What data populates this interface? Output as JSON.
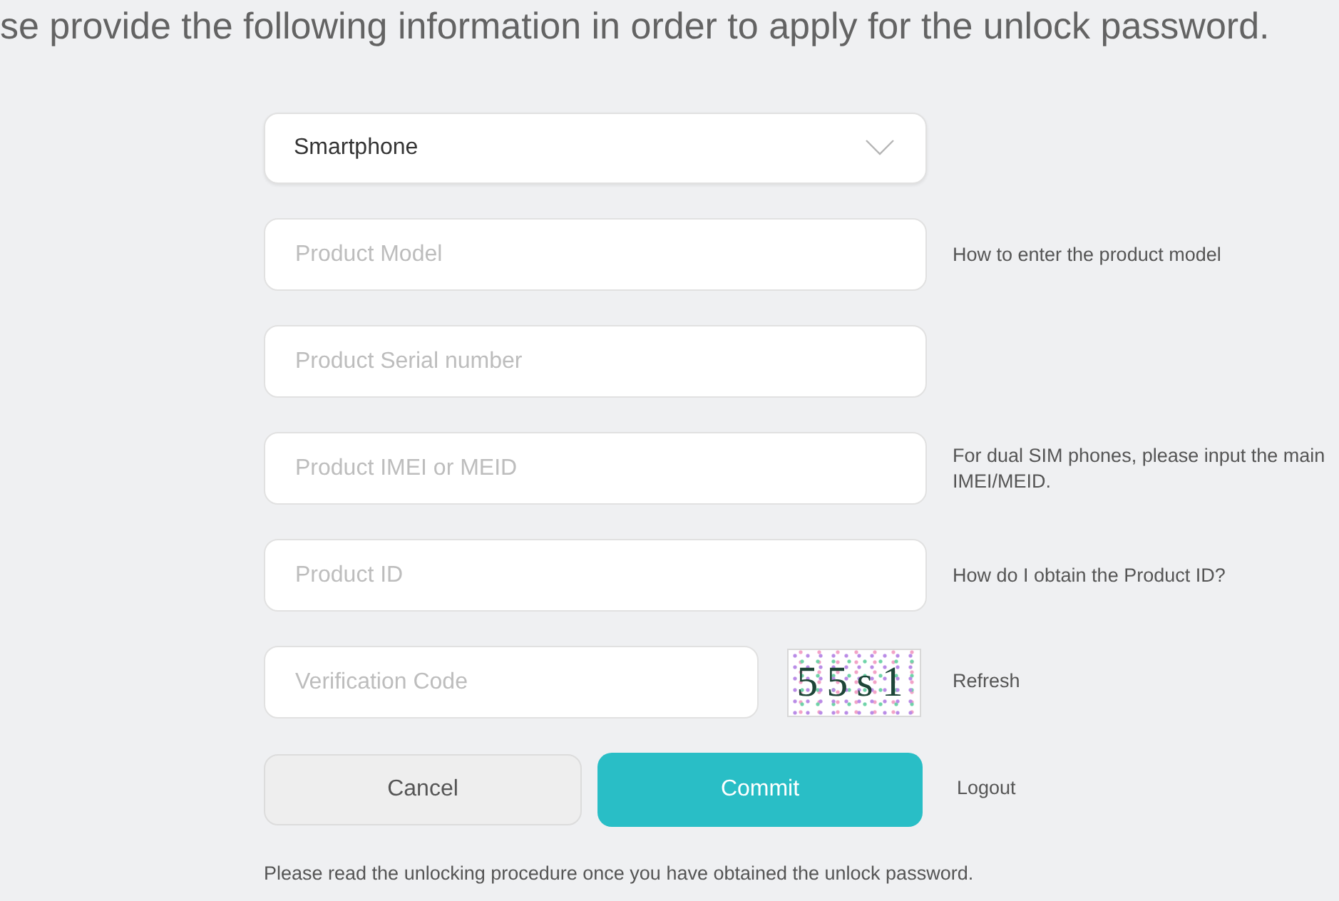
{
  "header": {
    "text": "se provide the following information in order to apply for the unlock password."
  },
  "device_type": {
    "value": "Smartphone"
  },
  "fields": [
    {
      "placeholder": "Product Model",
      "hint": {
        "text": "How to enter the product model",
        "kind": "link"
      }
    },
    {
      "placeholder": "Product Serial number"
    },
    {
      "placeholder": "Product IMEI or MEID",
      "hint": {
        "text": "For dual SIM phones, please input the main IMEI/MEID.",
        "kind": "note"
      }
    },
    {
      "placeholder": "Product ID",
      "hint": {
        "text": "How do I obtain the Product ID?",
        "kind": "link"
      }
    }
  ],
  "verification": {
    "placeholder": "Verification Code",
    "captcha": "55s1",
    "refresh": "Refresh"
  },
  "buttons": [
    {
      "label": "Cancel",
      "kind": "secondary"
    },
    {
      "label": "Commit",
      "kind": "primary"
    }
  ],
  "logout": "Logout",
  "footer_note": "Please read the unlocking procedure once you have obtained the unlock password."
}
